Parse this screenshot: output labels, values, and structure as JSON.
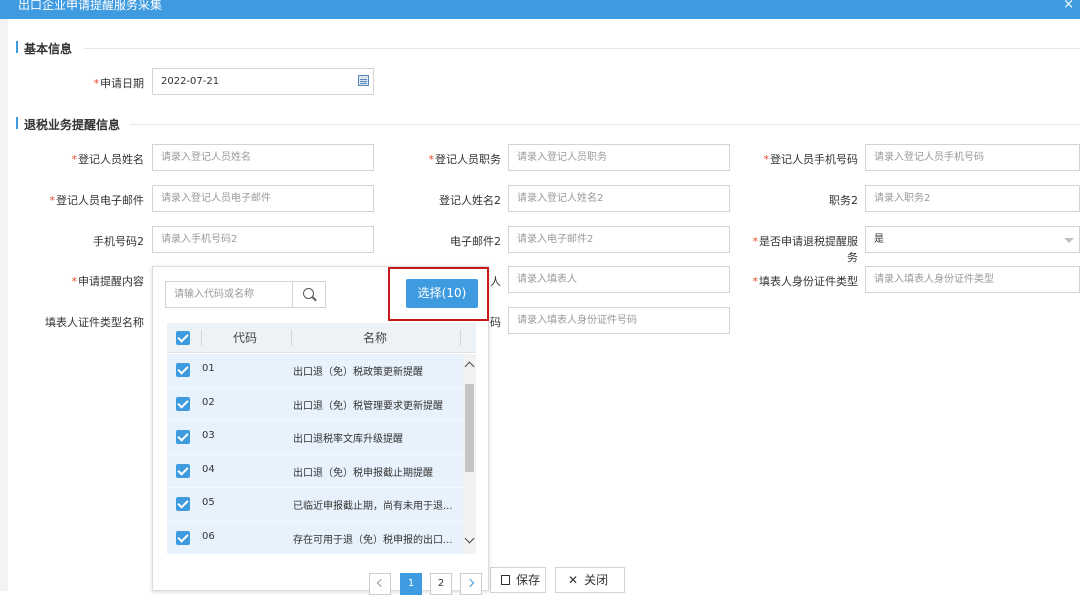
{
  "dialog": {
    "title": "出口企业申请提醒服务采集",
    "close_symbol": "×"
  },
  "basic_section": {
    "title": "基本信息",
    "apply_date": {
      "label": "申请日期",
      "value": "2022-07-21"
    }
  },
  "refund_section": {
    "title": "退税业务提醒信息",
    "fields": {
      "reg_name": {
        "label": "登记人员姓名",
        "placeholder": "请录入登记人员姓名"
      },
      "reg_title": {
        "label": "登记人员职务",
        "placeholder": "请录入登记人员职务"
      },
      "reg_phone": {
        "label": "登记人员手机号码",
        "placeholder": "请录入登记人员手机号码"
      },
      "reg_email": {
        "label": "登记人员电子邮件",
        "placeholder": "请录入登记人员电子邮件"
      },
      "reg_name2": {
        "label": "登记人姓名2",
        "placeholder": "请录入登记人姓名2"
      },
      "title2": {
        "label": "职务2",
        "placeholder": "请录入职务2"
      },
      "phone2": {
        "label": "手机号码2",
        "placeholder": "请录入手机号码2"
      },
      "email2": {
        "label": "电子邮件2",
        "placeholder": "请录入电子邮件2"
      },
      "apply_service": {
        "label": "是否申请退税提醒服务",
        "value": "是"
      },
      "remind_content": {
        "label": "申请提醒内容"
      },
      "filler": {
        "label_tail": "人",
        "placeholder": "请录入填表人"
      },
      "filler_id_type": {
        "label": "填表人身份证件类型",
        "placeholder": "请录入填表人身份证件类型"
      },
      "filler_id_type_name": {
        "label": "填表人证件类型名称"
      },
      "filler_id_no": {
        "label_tail": "码",
        "placeholder": "请录入填表人身份证件号码"
      }
    }
  },
  "popup": {
    "search_placeholder": "请输入代码或名称",
    "select_button": "选择(10)",
    "columns": {
      "code": "代码",
      "name": "名称"
    },
    "rows": [
      {
        "code": "01",
        "name": "出口退（免）税政策更新提醒",
        "checked": true
      },
      {
        "code": "02",
        "name": "出口退（免）税管理要求更新提醒",
        "checked": true
      },
      {
        "code": "03",
        "name": "出口退税率文库升级提醒",
        "checked": true
      },
      {
        "code": "04",
        "name": "出口退（免）税申报截止期提醒",
        "checked": true
      },
      {
        "code": "05",
        "name": "已临近申报截止期，尚有未用于退...",
        "checked": true
      },
      {
        "code": "06",
        "name": "存在可用于退（免）税申报的出口...",
        "checked": true
      }
    ],
    "pages": [
      "1",
      "2"
    ],
    "current_page": "1"
  },
  "footer": {
    "save_label": "保存",
    "close_label": "关闭"
  },
  "colors": {
    "accent": "#3f9bdf",
    "required": "#e6492a",
    "highlight_box": "#c41a1a"
  }
}
